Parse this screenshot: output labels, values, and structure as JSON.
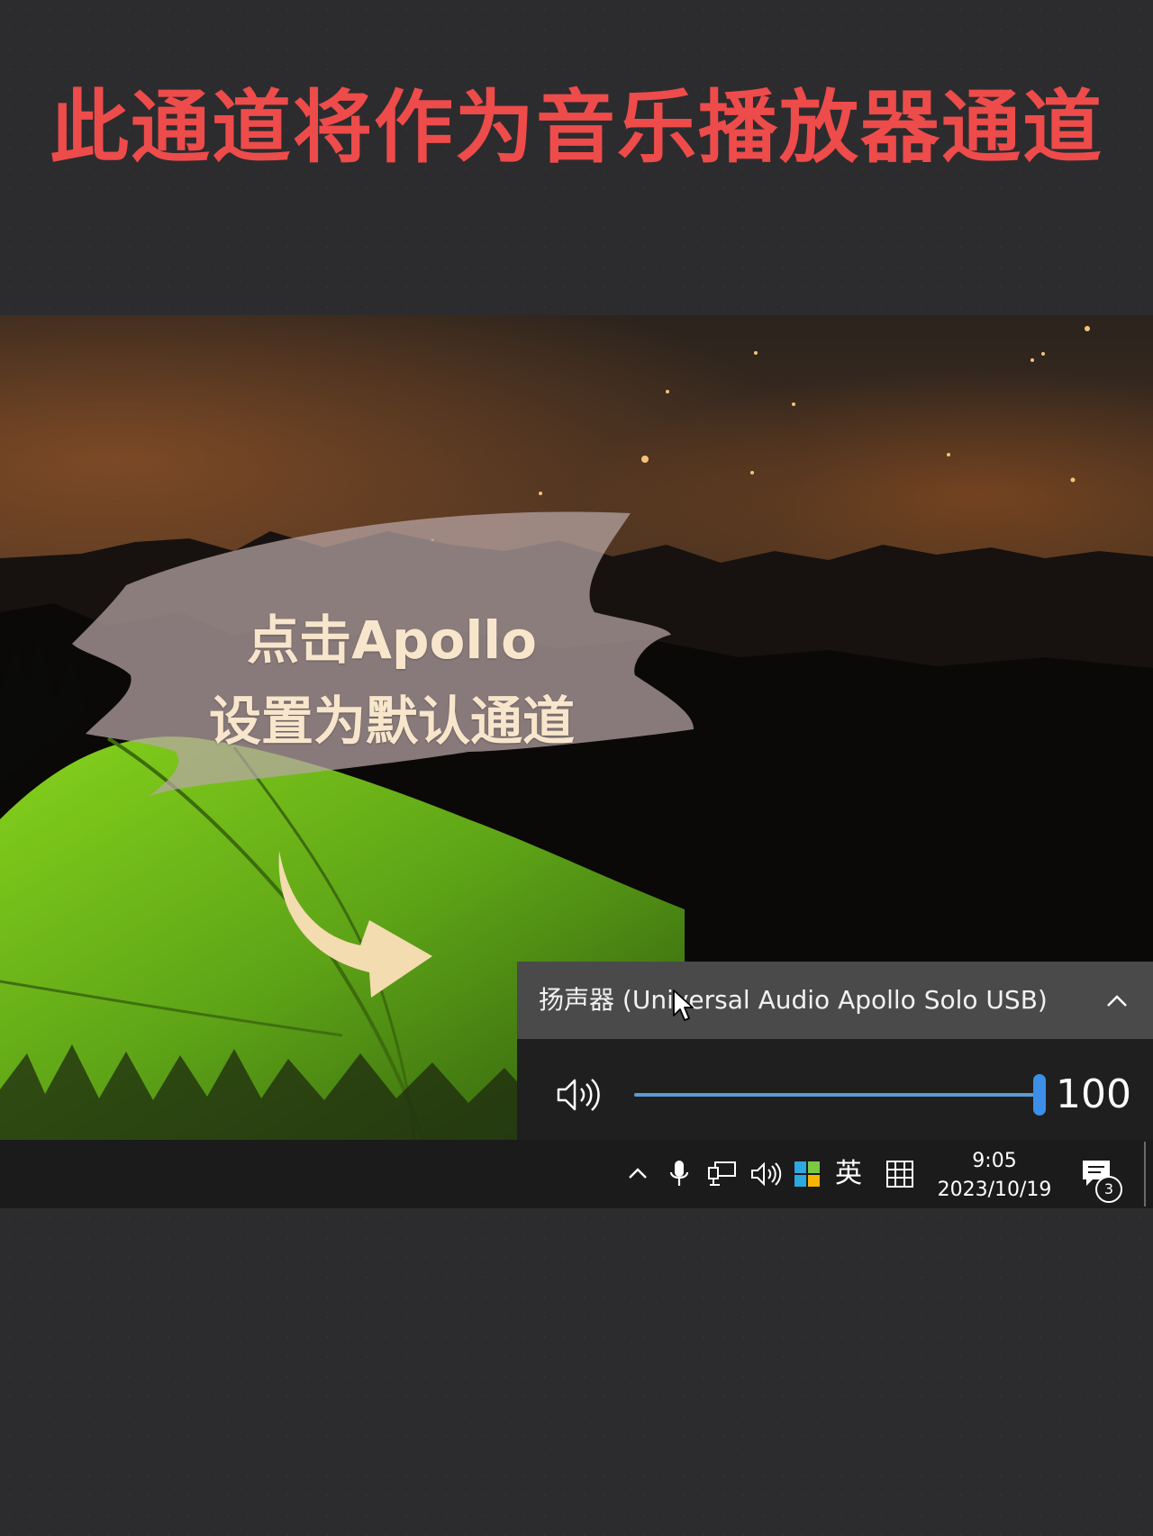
{
  "headline": "此通道将作为音乐播放器通道",
  "callout": {
    "line1": "点击Apollo",
    "line2": "设置为默认通道"
  },
  "volume_flyout": {
    "device_name": "扬声器 (Universal Audio Apollo Solo USB)",
    "volume_percent": 100,
    "volume_label": "100",
    "accent_color": "#3c8ee8",
    "icons": [
      "speaker-icon",
      "chevron-up-icon"
    ]
  },
  "taskbar": {
    "tray_icons": [
      "chevron-up-icon",
      "microphone-icon",
      "network-icon",
      "speaker-icon",
      "app-tile-icon",
      "ime-pinyin-icon",
      "notification-icon"
    ],
    "ime_language": "英",
    "time": "9:05",
    "date": "2023/10/19",
    "notification_count": "3"
  }
}
